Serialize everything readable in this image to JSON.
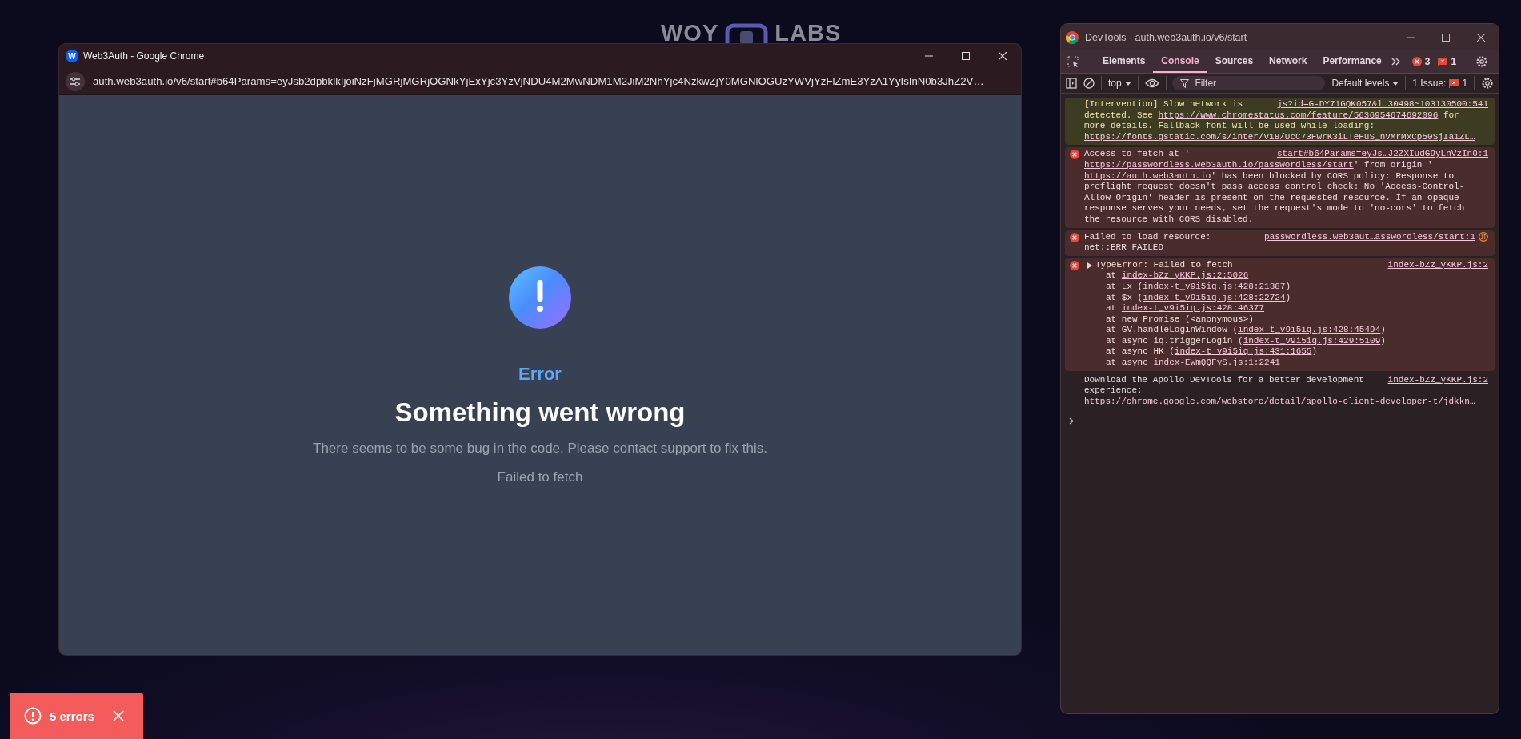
{
  "background_logo": {
    "left_text": "WOY",
    "right_text": "LABS"
  },
  "browser_window": {
    "favicon_letter": "W",
    "title": "Web3Auth - Google Chrome",
    "url": "auth.web3auth.io/v6/start#b64Params=eyJsb2dpbklkIjoiNzFjMGRjMGRjOGNkYjExYjc3YzVjNDU4M2MwNDM1M2JiM2NhYjc4NzkwZjY0MGNlOGUzYWVjYzFlZmE3YzA1YyIsInN0b3JhZ2V…",
    "error_page": {
      "label": "Error",
      "title": "Something went wrong",
      "message": "There seems to be some bug in the code. Please contact support to fix this.",
      "detail": "Failed to fetch"
    }
  },
  "devtools": {
    "title": "DevTools - auth.web3auth.io/v6/start",
    "tabs": [
      {
        "label": "Elements",
        "selected": false
      },
      {
        "label": "Console",
        "selected": true
      },
      {
        "label": "Sources",
        "selected": false
      },
      {
        "label": "Network",
        "selected": false
      },
      {
        "label": "Performance",
        "selected": false
      }
    ],
    "error_count": "3",
    "issue_count": "1",
    "toolbar": {
      "context": "top",
      "filter_placeholder": "Filter",
      "levels": "Default levels",
      "issues_label": "1 Issue:",
      "issues_count": "1"
    },
    "messages": [
      {
        "kind": "warning",
        "source": "js?id=G-DY71GQK057&l…30498~103130500:541",
        "lines": [
          [
            "[Intervention] Slow network is"
          ],
          [
            "detected. See ",
            {
              "link": "https://www.chromestatus.com/feature/5636954674692096"
            },
            " for"
          ],
          [
            "more details. Fallback font will be used while loading:"
          ],
          [
            {
              "link": "https://fonts.gstatic.com/s/inter/v18/UcC73FwrK3iLTeHuS_nVMrMxCp50SjIa1ZL…"
            }
          ]
        ]
      },
      {
        "kind": "error",
        "source": "start#b64Params=eyJs…J2ZXIudG9yLnVzIn0:1",
        "lines": [
          [
            "Access to fetch at '"
          ],
          [
            {
              "link": "https://passwordless.web3auth.io/passwordless/start"
            },
            "' from origin '"
          ],
          [
            {
              "link": "https://auth.web3auth.io"
            },
            "' has been blocked by CORS policy: Response to"
          ],
          [
            "preflight request doesn't pass access control check: No 'Access-Control-"
          ],
          [
            "Allow-Origin' header is present on the requested resource. If an opaque"
          ],
          [
            "response serves your needs, set the request's mode to 'no-cors' to fetch"
          ],
          [
            "the resource with CORS disabled."
          ]
        ]
      },
      {
        "kind": "error",
        "source": "passwordless.web3aut…asswordless/start:1",
        "network_icon": true,
        "lines": [
          [
            "Failed to load resource:"
          ],
          [
            "net::ERR_FAILED"
          ]
        ]
      },
      {
        "kind": "error",
        "source": "index-bZz_yKKP.js:2",
        "expandable": true,
        "lines": [
          [
            "TypeError: Failed to fetch"
          ]
        ],
        "trace": [
          [
            "at ",
            {
              "link": "index-bZz_yKKP.js:2:5026"
            }
          ],
          [
            "at Lx (",
            {
              "link": "index-t_v9i5iq.js:428:21387"
            },
            ")"
          ],
          [
            "at $x (",
            {
              "link": "index-t_v9i5iq.js:428:22724"
            },
            ")"
          ],
          [
            "at ",
            {
              "link": "index-t_v9i5iq.js:428:46377"
            }
          ],
          [
            "at new Promise (<anonymous>)"
          ],
          [
            "at GV.handleLoginWindow (",
            {
              "link": "index-t_v9i5iq.js:428:45494"
            },
            ")"
          ],
          [
            "at async iq.triggerLogin (",
            {
              "link": "index-t_v9i5iq.js:429:5109"
            },
            ")"
          ],
          [
            "at async HK (",
            {
              "link": "index-t_v9i5iq.js:431:1655"
            },
            ")"
          ],
          [
            "at async ",
            {
              "link": "index-EWmQQFyS.js:1:2241"
            }
          ]
        ]
      },
      {
        "kind": "info",
        "source": "index-bZz_yKKP.js:2",
        "lines": [
          [
            "Download the Apollo DevTools for a better development"
          ],
          [
            "experience:"
          ],
          [
            {
              "link": "https://chrome.google.com/webstore/detail/apollo-client-developer-t/jdkkn…"
            }
          ]
        ]
      }
    ]
  },
  "toast": {
    "label": "5 errors"
  }
}
